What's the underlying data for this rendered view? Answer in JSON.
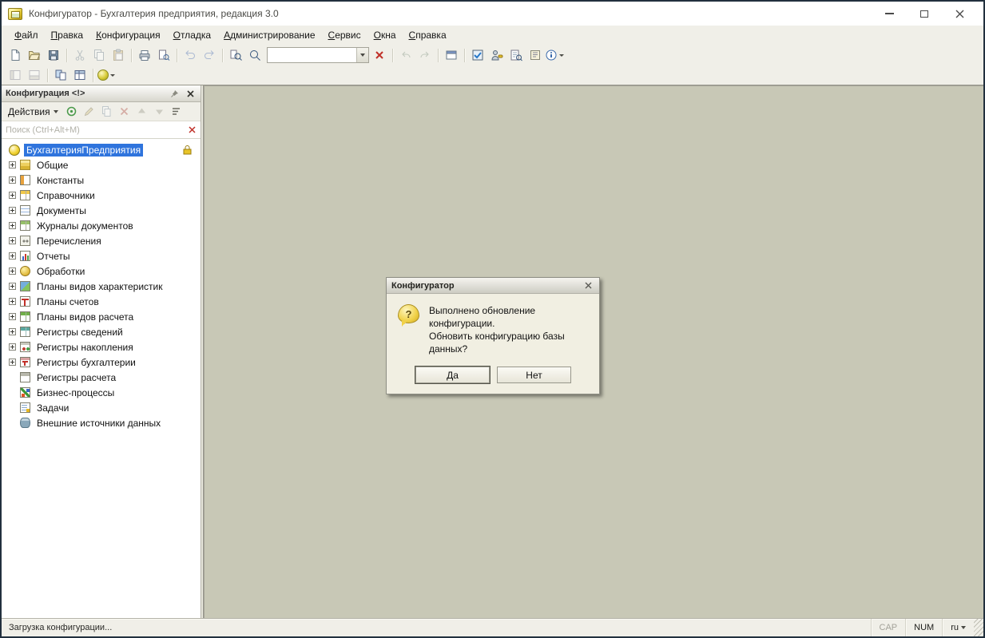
{
  "theme": {
    "workspace_bg": "#c8c8b6",
    "chrome_bg": "#f0efe8",
    "selection_bg": "#2f74dd",
    "selection_fg": "#ffffff",
    "titlebar_bg": "#ffffff",
    "window_border": "#22303e",
    "clear_icon_red": "#c03028"
  },
  "window": {
    "title": "Конфигуратор - Бухгалтерия предприятия, редакция 3.0"
  },
  "menu": {
    "items": [
      {
        "accel": "Ф",
        "rest": "айл"
      },
      {
        "accel": "П",
        "rest": "равка"
      },
      {
        "accel": "К",
        "rest": "онфигурация"
      },
      {
        "accel": "О",
        "rest": "тладка"
      },
      {
        "accel": "А",
        "rest": "дминистрирование"
      },
      {
        "accel": "С",
        "rest": "ервис"
      },
      {
        "accel": "О",
        "rest": "кна"
      },
      {
        "accel": "С",
        "rest": "правка"
      }
    ]
  },
  "toolbar": {
    "quick_search_value": "",
    "icons_row1": [
      "new-document",
      "open",
      "save",
      "cut",
      "copy",
      "paste",
      "print",
      "print-preview",
      "undo",
      "redo",
      "find",
      "zoom",
      "quick-search-combobox",
      "clear-search",
      "go-back",
      "go-forward",
      "windows",
      "check-syntax",
      "configure-users",
      "find-in-texts",
      "help-contents",
      "info"
    ],
    "icons_row2": [
      "layout-left",
      "layout-bottom",
      "compare-configurations",
      "table-settings",
      "start-debugging"
    ]
  },
  "panel": {
    "title": "Конфигурация <!>",
    "actions_label": "Действия",
    "search_placeholder": "Поиск (Ctrl+Alt+M)",
    "tree": {
      "root": "БухгалтерияПредприятия",
      "items": [
        {
          "label": "Общие",
          "icon": "commons"
        },
        {
          "label": "Константы",
          "icon": "constants"
        },
        {
          "label": "Справочники",
          "icon": "catalogs"
        },
        {
          "label": "Документы",
          "icon": "documents"
        },
        {
          "label": "Журналы документов",
          "icon": "document-journals"
        },
        {
          "label": "Перечисления",
          "icon": "enumerations"
        },
        {
          "label": "Отчеты",
          "icon": "reports"
        },
        {
          "label": "Обработки",
          "icon": "data-processors"
        },
        {
          "label": "Планы видов характеристик",
          "icon": "chart-of-characteristic-types"
        },
        {
          "label": "Планы счетов",
          "icon": "chart-of-accounts"
        },
        {
          "label": "Планы видов расчета",
          "icon": "chart-of-calculation-types"
        },
        {
          "label": "Регистры сведений",
          "icon": "information-registers"
        },
        {
          "label": "Регистры накопления",
          "icon": "accumulation-registers"
        },
        {
          "label": "Регистры бухгалтерии",
          "icon": "accounting-registers"
        },
        {
          "label": "Регистры расчета",
          "icon": "calculation-registers"
        },
        {
          "label": "Бизнес-процессы",
          "icon": "business-processes"
        },
        {
          "label": "Задачи",
          "icon": "tasks"
        },
        {
          "label": "Внешние источники данных",
          "icon": "external-data-sources"
        }
      ]
    }
  },
  "dialog": {
    "title": "Конфигуратор",
    "icon_glyph": "?",
    "message_line1": "Выполнено обновление конфигурации.",
    "message_line2": "Обновить конфигурацию базы данных?",
    "yes_label": "Да",
    "no_label": "Нет"
  },
  "statusbar": {
    "loading_text": "Загрузка конфигурации...",
    "cap_label": "CAP",
    "num_label": "NUM",
    "lang_label": "ru"
  }
}
